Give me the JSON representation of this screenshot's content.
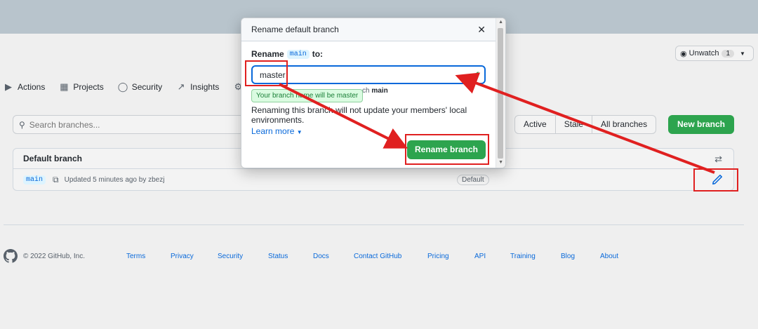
{
  "topbar": {},
  "watch": {
    "label": "Unwatch",
    "count": "1"
  },
  "repo_nav": {
    "tabs": [
      {
        "label": "Actions",
        "icon": "play-icon"
      },
      {
        "label": "Projects",
        "icon": "table-icon"
      },
      {
        "label": "Security",
        "icon": "shield-icon"
      },
      {
        "label": "Insights",
        "icon": "graph-icon"
      }
    ]
  },
  "branches": {
    "search_placeholder": "Search branches...",
    "filters": [
      "Active",
      "Stale",
      "All branches"
    ],
    "new_branch_label": "New branch",
    "default_heading": "Default branch",
    "row": {
      "name": "main",
      "updated": "Updated 5 minutes ago by zbezj",
      "badge": "Default"
    }
  },
  "footer": {
    "copyright": "© 2022 GitHub, Inc.",
    "links": [
      "Terms",
      "Privacy",
      "Security",
      "Status",
      "Docs",
      "Contact GitHub",
      "Pricing",
      "API",
      "Training",
      "Blog",
      "About"
    ]
  },
  "modal": {
    "title": "Rename default branch",
    "rename_prefix": "Rename",
    "rename_code": "main",
    "rename_suffix": "to:",
    "input_value": "master",
    "tooltip": "Your branch name will be master",
    "hidden_note_tail": "ch",
    "hidden_note_bold": "main",
    "info": "Renaming this branch will not update your members' local environments.",
    "learn_more": "Learn more",
    "submit_label": "Rename branch"
  },
  "colors": {
    "primary_green": "#2da44e",
    "link_blue": "#0969da",
    "annotation_red": "#e02020"
  }
}
